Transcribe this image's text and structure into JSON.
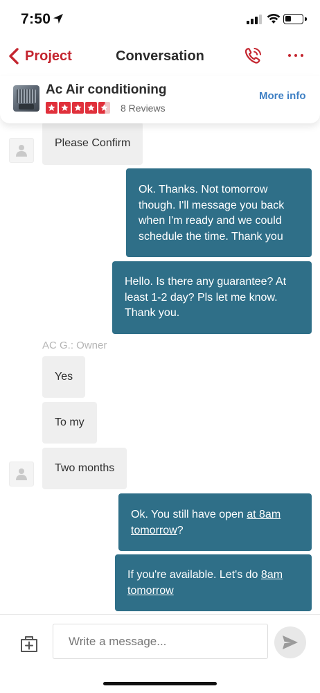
{
  "status_bar": {
    "time": "7:50",
    "battery_level": 0.35,
    "signal_bars": 3
  },
  "nav": {
    "back_label": "Project",
    "title": "Conversation",
    "accent_color": "#c4252f"
  },
  "business": {
    "name": "Ac Air conditioning",
    "rating": 4.5,
    "reviews_label": "8 Reviews",
    "more_info_label": "More info"
  },
  "messages": [
    {
      "direction": "in",
      "text": "Please Confirm",
      "avatar": true
    },
    {
      "direction": "out",
      "lines": [
        "Ok. Thanks. Not tomorrow",
        "though. I'll message you back",
        "when I'm ready and we could",
        "schedule the time. Thank you"
      ]
    },
    {
      "direction": "out",
      "lines": [
        "Hello. Is there any guarantee? At",
        "least 1-2 day? Pls let me know.",
        "Thank you."
      ]
    },
    {
      "direction": "in",
      "sender": "AC G.: Owner",
      "text": "Yes"
    },
    {
      "direction": "in",
      "text": "To my"
    },
    {
      "direction": "in",
      "text": "Two months",
      "avatar": true
    },
    {
      "direction": "out",
      "line1_plain": "Ok. You still  have open ",
      "line1_link": "at 8am",
      "line2_link": "tomorrow",
      "line2_plain": "?"
    },
    {
      "direction": "out",
      "line1_plain": "If you're available. Let's do ",
      "line1_link": "8am",
      "line2_link": "tomorrow"
    }
  ],
  "composer": {
    "placeholder": "Write a message..."
  },
  "colors": {
    "outgoing_bubble": "#2f6f88",
    "incoming_bubble": "#efefef",
    "link_blue": "#3d7fc4",
    "star_red": "#e0303b"
  }
}
